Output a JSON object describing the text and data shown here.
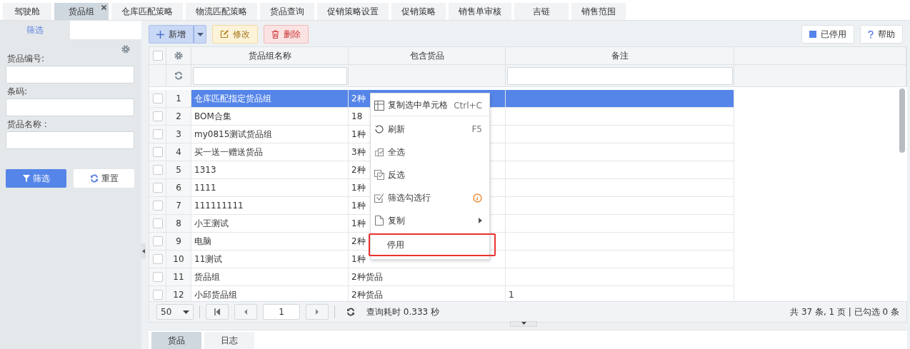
{
  "top_tabs": [
    {
      "label": "驾驶舱",
      "selected": false,
      "closable": false
    },
    {
      "label": "货品组",
      "selected": true,
      "closable": true
    },
    {
      "label": "仓库匹配策略",
      "selected": false,
      "closable": false
    },
    {
      "label": "物流匹配策略",
      "selected": false,
      "closable": false
    },
    {
      "label": "货品查询",
      "selected": false,
      "closable": false
    },
    {
      "label": "促销策略设置",
      "selected": false,
      "closable": false
    },
    {
      "label": "促销策略",
      "selected": false,
      "closable": false
    },
    {
      "label": "销售单审核",
      "selected": false,
      "closable": false
    },
    {
      "label": "吉链",
      "selected": false,
      "closable": false
    },
    {
      "label": "销售范围",
      "selected": false,
      "closable": false
    }
  ],
  "filter_panel": {
    "tabs": [
      {
        "label": "筛选",
        "selected": true
      }
    ],
    "fields": [
      {
        "label": "货品编号:"
      },
      {
        "label": "条码:"
      },
      {
        "label": "货品名称 :"
      }
    ],
    "buttons": [
      {
        "label": "筛选",
        "kind": "primary"
      },
      {
        "label": "重置",
        "kind": "default"
      }
    ]
  },
  "toolbar": {
    "left": [
      {
        "label": "新增",
        "kind": "add"
      },
      {
        "label": "修改",
        "kind": "edit"
      },
      {
        "label": "删除",
        "kind": "delete"
      }
    ],
    "right": [
      {
        "label": "已停用",
        "kind": "stopped"
      },
      {
        "label": "帮助",
        "kind": "help"
      }
    ]
  },
  "table": {
    "header_checked": false,
    "columns": [
      "货品组名称",
      "包含货品",
      "备注"
    ],
    "rows": [
      {
        "index": "1",
        "name": "仓库匹配指定货品组",
        "contents": "2种",
        "selected": true,
        "checked": false
      },
      {
        "index": "2",
        "name": "BOM合集",
        "contents": "18",
        "selected": false,
        "checked": false
      },
      {
        "index": "3",
        "name": "my0815测试货品组",
        "contents": "1种",
        "selected": false,
        "checked": false
      },
      {
        "index": "4",
        "name": "买一送一赠送货品",
        "contents": "3种",
        "selected": false,
        "checked": false
      },
      {
        "index": "5",
        "name": "1313",
        "contents": "2种",
        "selected": false,
        "checked": false
      },
      {
        "index": "6",
        "name": "1111",
        "contents": "1种",
        "selected": false,
        "checked": false
      },
      {
        "index": "7",
        "name": "111111111",
        "contents": "1种",
        "selected": false,
        "checked": false
      },
      {
        "index": "8",
        "name": "小王测试",
        "contents": "1种",
        "selected": false,
        "checked": false
      },
      {
        "index": "9",
        "name": "电脑",
        "contents": "2种",
        "selected": false,
        "checked": false
      },
      {
        "index": "10",
        "name": "11测试",
        "contents": "1种",
        "selected": false,
        "checked": false
      },
      {
        "index": "11",
        "name": "货品组",
        "contents": "2种货品",
        "selected": false,
        "checked": false
      },
      {
        "index": "12",
        "name": "小邱货品组",
        "contents": "2种货品",
        "remark": "1",
        "selected": false,
        "checked": false
      }
    ]
  },
  "context_menu": [
    {
      "label": "复制选中单元格",
      "shortcut": "Ctrl+C",
      "selected": false,
      "info": false,
      "submenu": false
    },
    {
      "label": "刷新",
      "shortcut": "F5",
      "selected": false,
      "info": false,
      "submenu": false
    },
    {
      "label": "全选",
      "selected": false,
      "info": false,
      "submenu": false
    },
    {
      "label": "反选",
      "selected": false,
      "info": false,
      "submenu": false
    },
    {
      "label": "筛选勾选行",
      "selected": false,
      "info": true,
      "submenu": false
    },
    {
      "label": "复制",
      "selected": false,
      "info": false,
      "submenu": true
    },
    {
      "label": "停用",
      "selected": true,
      "info": false,
      "submenu": false
    }
  ],
  "pager": {
    "page_size": "50",
    "page": "1",
    "query_time": "查询耗时 0.333 秒",
    "summary": "共 37 条, 1 页 | 已勾选 0 条"
  },
  "bottom_tabs": [
    {
      "label": "货品",
      "selected": true
    },
    {
      "label": "日志",
      "selected": false
    }
  ]
}
